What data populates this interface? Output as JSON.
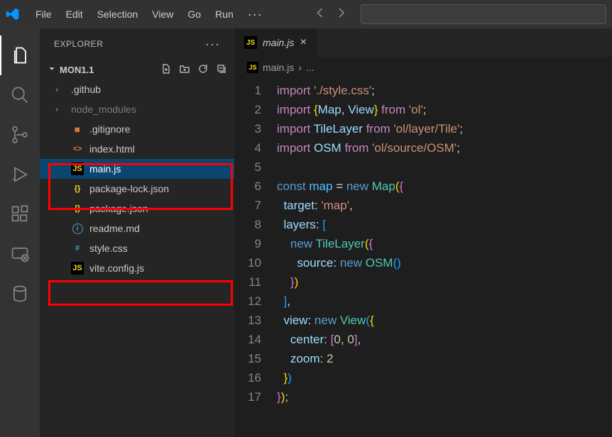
{
  "menus": [
    "File",
    "Edit",
    "Selection",
    "View",
    "Go",
    "Run"
  ],
  "explorer_title": "EXPLORER",
  "folder_name": "MON1.1",
  "tree": [
    {
      "name": ".github",
      "kind": "folder",
      "chev": "›",
      "dim": false
    },
    {
      "name": "node_modules",
      "kind": "folder",
      "chev": "›",
      "dim": true
    },
    {
      "name": ".gitignore",
      "kind": "gitignore",
      "dim": false
    },
    {
      "name": "index.html",
      "kind": "html",
      "dim": false
    },
    {
      "name": "main.js",
      "kind": "js",
      "dim": false,
      "selected": true
    },
    {
      "name": "package-lock.json",
      "kind": "json",
      "dim": false
    },
    {
      "name": "package.json",
      "kind": "json",
      "dim": false
    },
    {
      "name": "readme.md",
      "kind": "md",
      "dim": false
    },
    {
      "name": "style.css",
      "kind": "css",
      "dim": false
    },
    {
      "name": "vite.config.js",
      "kind": "js",
      "dim": false
    }
  ],
  "tab": {
    "label": "main.js"
  },
  "breadcrumb": {
    "file": "main.js",
    "sep": "›",
    "more": "..."
  },
  "code_lines": 17,
  "code_content": {
    "line1_import": "import",
    "line1_str": "'./style.css'",
    "line2_import": "import",
    "line2_str": "'ol'",
    "line2_from": "from",
    "line2_Map": "Map",
    "line2_View": "View",
    "line3_import": "import",
    "line3_TileLayer": "TileLayer",
    "line3_from": "from",
    "line3_str": "'ol/layer/Tile'",
    "line4_import": "import",
    "line4_OSM": "OSM",
    "line4_from": "from",
    "line4_str": "'ol/source/OSM'",
    "line6_const": "const",
    "line6_map": "map",
    "line6_new": "new",
    "line6_Map": "Map",
    "line7_target": "target",
    "line7_val": "'map'",
    "line8_layers": "layers",
    "line9_new": "new",
    "line9_TileLayer": "TileLayer",
    "line10_source": "source",
    "line10_new": "new",
    "line10_OSM": "OSM",
    "line13_view": "view",
    "line13_new": "new",
    "line13_View": "View",
    "line14_center": "center",
    "line14_a": "0",
    "line14_b": "0",
    "line15_zoom": "zoom",
    "line15_val": "2"
  }
}
